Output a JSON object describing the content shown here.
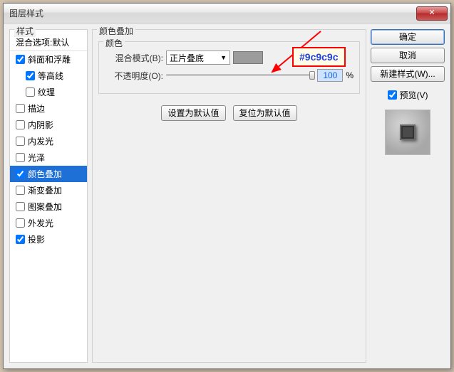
{
  "window": {
    "title": "图层样式",
    "close": "✕"
  },
  "styles": {
    "legend": "样式",
    "blend_default": "混合选项:默认",
    "items": [
      {
        "label": "斜面和浮雕",
        "checked": true,
        "sub": false
      },
      {
        "label": "等高线",
        "checked": true,
        "sub": true
      },
      {
        "label": "纹理",
        "checked": false,
        "sub": true
      },
      {
        "label": "描边",
        "checked": false,
        "sub": false
      },
      {
        "label": "内阴影",
        "checked": false,
        "sub": false
      },
      {
        "label": "内发光",
        "checked": false,
        "sub": false
      },
      {
        "label": "光泽",
        "checked": false,
        "sub": false
      },
      {
        "label": "颜色叠加",
        "checked": true,
        "sub": false,
        "selected": true
      },
      {
        "label": "渐变叠加",
        "checked": false,
        "sub": false
      },
      {
        "label": "图案叠加",
        "checked": false,
        "sub": false
      },
      {
        "label": "外发光",
        "checked": false,
        "sub": false
      },
      {
        "label": "投影",
        "checked": true,
        "sub": false
      }
    ]
  },
  "panel": {
    "title": "颜色叠加",
    "group": "颜色",
    "blend_label": "混合模式(B):",
    "blend_value": "正片叠底",
    "color_hex": "#9c9c9c",
    "opacity_label": "不透明度(O):",
    "opacity_value": "100",
    "opacity_unit": "%",
    "set_default": "设置为默认值",
    "reset_default": "复位为默认值"
  },
  "buttons": {
    "ok": "确定",
    "cancel": "取消",
    "new_style": "新建样式(W)...",
    "preview": "预览(V)"
  },
  "annotation": {
    "hex": "#9c9c9c"
  }
}
